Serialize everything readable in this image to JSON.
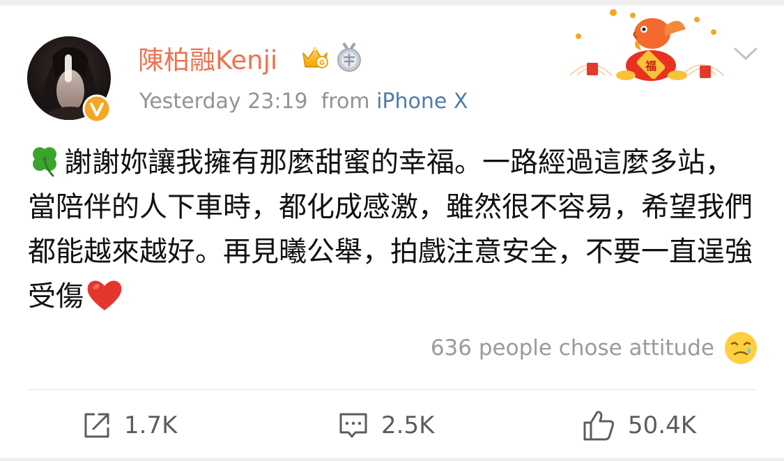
{
  "post": {
    "author": {
      "name": "陳柏融Kenji",
      "verified_badge": "verified-v-badge",
      "member_badge": "vip-crown-badge",
      "extra_badge": "silver-medal-badge"
    },
    "time": "Yesterday 23:19",
    "source_prefix": "from",
    "source": "iPhone X",
    "text": "謝謝妳讓我擁有那麼甜蜜的幸福。一路經過這麼多站，當陪伴的人下車時，都化成感激，雖然很不容易，希望我們都能越來越好。再見曦公舉，拍戲注意安全，不要一直逞強受傷",
    "leading_emoji": "four-leaf-clover",
    "trailing_emoji": "red-heart",
    "attitude_text": "636 people chose attitude",
    "attitude_emoji": "tearful-smiling-face",
    "banner_icon": "koi-fish-new-year-banner",
    "menu_icon": "chevron-down"
  },
  "actions": {
    "repost": {
      "icon": "repost-icon",
      "count": "1.7K"
    },
    "comment": {
      "icon": "comment-icon",
      "count": "2.5K"
    },
    "like": {
      "icon": "thumbs-up-icon",
      "count": "50.4K"
    }
  },
  "colors": {
    "username": "#eb7350",
    "meta": "#939393",
    "source_link": "#4f7cac",
    "attitude_text": "#9a9a9a",
    "action_text": "#5c5c5c",
    "heart": "#e5362e",
    "verified_badge": "#f5a623"
  }
}
